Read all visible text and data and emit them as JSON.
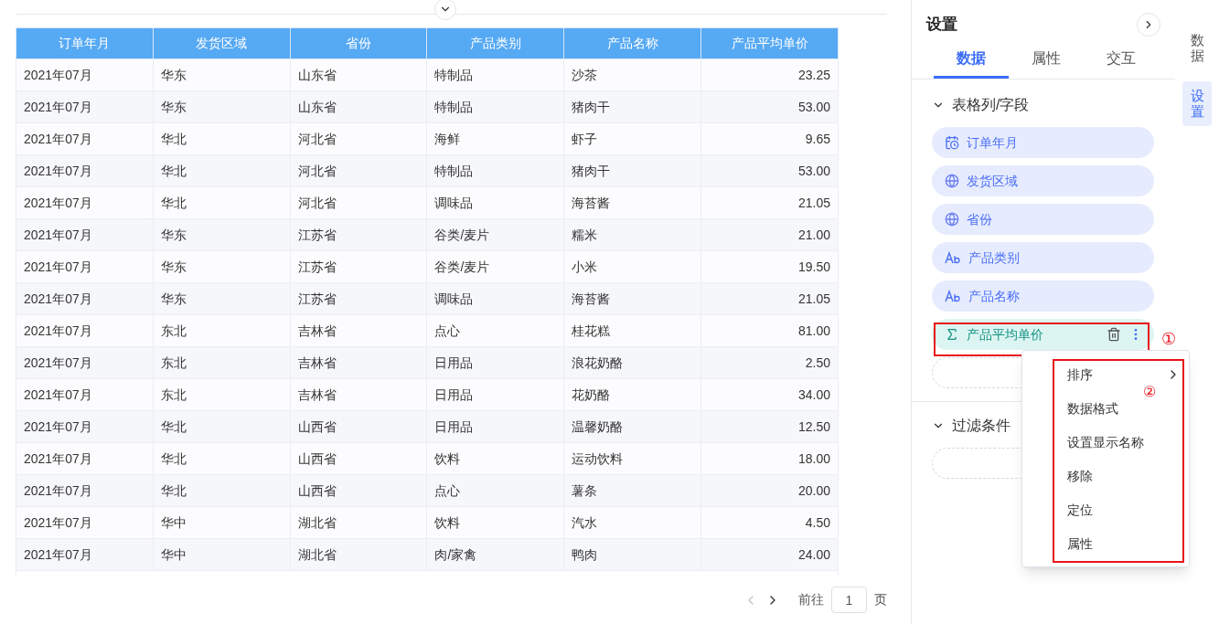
{
  "table": {
    "columns": [
      {
        "label": "订单年月",
        "kind": "text"
      },
      {
        "label": "发货区域",
        "kind": "text"
      },
      {
        "label": "省份",
        "kind": "text"
      },
      {
        "label": "产品类别",
        "kind": "text"
      },
      {
        "label": "产品名称",
        "kind": "text"
      },
      {
        "label": "产品平均单价",
        "kind": "number"
      }
    ],
    "rows": [
      [
        "2021年07月",
        "华东",
        "山东省",
        "特制品",
        "沙茶",
        "23.25"
      ],
      [
        "2021年07月",
        "华东",
        "山东省",
        "特制品",
        "猪肉干",
        "53.00"
      ],
      [
        "2021年07月",
        "华北",
        "河北省",
        "海鲜",
        "虾子",
        "9.65"
      ],
      [
        "2021年07月",
        "华北",
        "河北省",
        "特制品",
        "猪肉干",
        "53.00"
      ],
      [
        "2021年07月",
        "华北",
        "河北省",
        "调味品",
        "海苔酱",
        "21.05"
      ],
      [
        "2021年07月",
        "华东",
        "江苏省",
        "谷类/麦片",
        "糯米",
        "21.00"
      ],
      [
        "2021年07月",
        "华东",
        "江苏省",
        "谷类/麦片",
        "小米",
        "19.50"
      ],
      [
        "2021年07月",
        "华东",
        "江苏省",
        "调味品",
        "海苔酱",
        "21.05"
      ],
      [
        "2021年07月",
        "东北",
        "吉林省",
        "点心",
        "桂花糕",
        "81.00"
      ],
      [
        "2021年07月",
        "东北",
        "吉林省",
        "日用品",
        "浪花奶酪",
        "2.50"
      ],
      [
        "2021年07月",
        "东北",
        "吉林省",
        "日用品",
        "花奶酪",
        "34.00"
      ],
      [
        "2021年07月",
        "华北",
        "山西省",
        "日用品",
        "温馨奶酪",
        "12.50"
      ],
      [
        "2021年07月",
        "华北",
        "山西省",
        "饮料",
        "运动饮料",
        "18.00"
      ],
      [
        "2021年07月",
        "华北",
        "山西省",
        "点心",
        "薯条",
        "20.00"
      ],
      [
        "2021年07月",
        "华中",
        "湖北省",
        "饮料",
        "汽水",
        "4.50"
      ],
      [
        "2021年07月",
        "华中",
        "湖北省",
        "肉/家禽",
        "鸭肉",
        "24.00"
      ]
    ]
  },
  "pagination": {
    "prev_disabled": true,
    "next_disabled": false,
    "goto_label": "前往",
    "page": "1",
    "page_suffix": "页"
  },
  "settings_panel": {
    "title": "设置",
    "tabs": [
      {
        "label": "数据",
        "selected": true
      },
      {
        "label": "属性",
        "selected": false
      },
      {
        "label": "交互",
        "selected": false
      }
    ],
    "sections": [
      {
        "title": "表格列/字段",
        "expanded": true,
        "fields": [
          {
            "label": "订单年月",
            "kind": "date",
            "selected": false
          },
          {
            "label": "发货区域",
            "kind": "geo",
            "selected": false
          },
          {
            "label": "省份",
            "kind": "geo",
            "selected": false
          },
          {
            "label": "产品类别",
            "kind": "text",
            "selected": false
          },
          {
            "label": "产品名称",
            "kind": "text",
            "selected": false
          },
          {
            "label": "产品平均单价",
            "kind": "measure",
            "selected": true
          }
        ]
      },
      {
        "title": "过滤条件",
        "expanded": true
      }
    ]
  },
  "context_menu": [
    {
      "label": "排序",
      "submenu": true
    },
    {
      "label": "数据格式",
      "submenu": false
    },
    {
      "label": "设置显示名称",
      "submenu": false
    },
    {
      "label": "移除",
      "submenu": false
    },
    {
      "label": "定位",
      "submenu": false
    },
    {
      "label": "属性",
      "submenu": false
    }
  ],
  "annotations": [
    "①",
    "②"
  ],
  "side_rail": [
    {
      "label": "数据",
      "selected": false
    },
    {
      "label": "设置",
      "selected": true
    }
  ]
}
